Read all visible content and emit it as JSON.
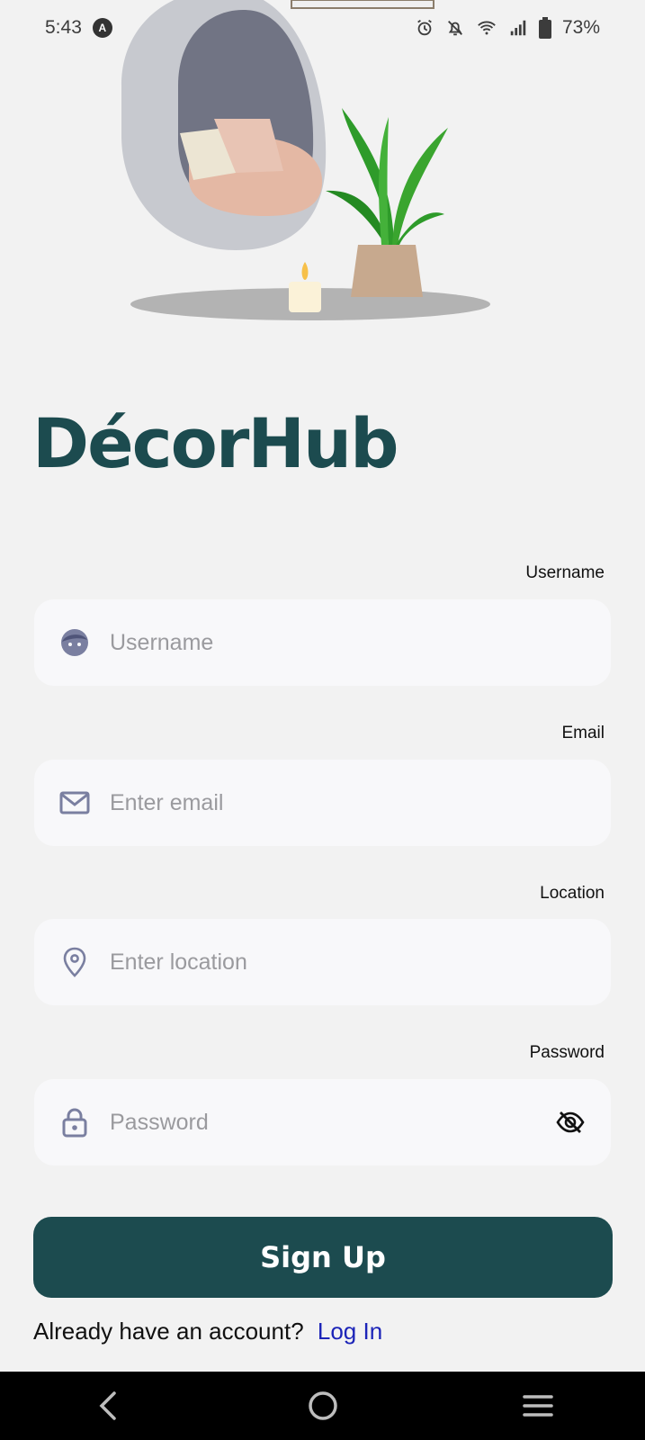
{
  "status_bar": {
    "time": "5:43",
    "battery": "73%"
  },
  "brand": {
    "title": "DécorHub"
  },
  "form": {
    "username": {
      "label": "Username",
      "placeholder": "Username"
    },
    "email": {
      "label": "Email",
      "placeholder": "Enter email"
    },
    "location": {
      "label": "Location",
      "placeholder": "Enter location"
    },
    "password": {
      "label": "Password",
      "placeholder": "Password"
    }
  },
  "actions": {
    "signup_label": "Sign Up",
    "login_prompt": "Already have an account?",
    "login_link": "Log In"
  },
  "icons": {
    "username": "face-icon",
    "email": "mail-icon",
    "location": "location-pin-icon",
    "password": "lock-icon",
    "toggle": "eye-off-icon"
  },
  "colors": {
    "brand": "#1c4b4f",
    "link": "#1c24b8",
    "field_bg": "#f8f8fa",
    "page_bg": "#f2f2f2"
  }
}
